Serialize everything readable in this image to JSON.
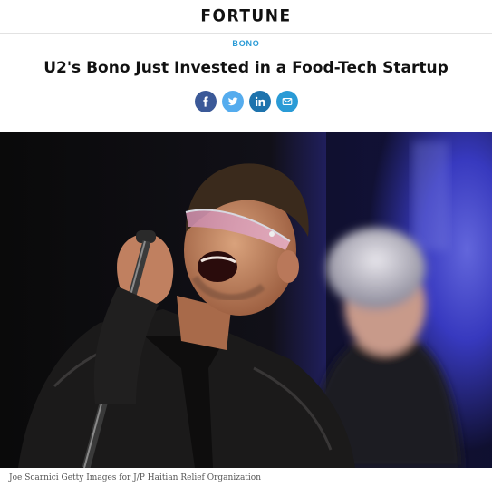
{
  "site": {
    "logo": "FORTUNE"
  },
  "article": {
    "section": "BONO",
    "title": "U2's Bono Just Invested in a Food-Tech Startup",
    "share": [
      {
        "icon": "facebook-icon",
        "color": "#3b5998"
      },
      {
        "icon": "twitter-icon",
        "color": "#55acee"
      },
      {
        "icon": "linkedin-icon",
        "color": "#1e73ad"
      },
      {
        "icon": "email-icon",
        "color": "#2a9bd6"
      }
    ],
    "image_caption": "Joe Scarnici Getty Images for J/P Haitian Relief Organization"
  }
}
